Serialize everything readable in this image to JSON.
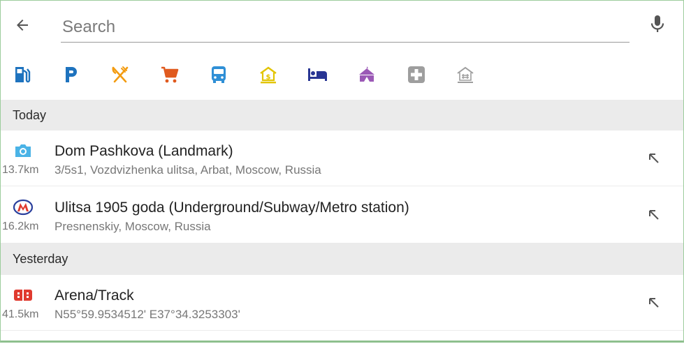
{
  "search": {
    "placeholder": "Search",
    "value": ""
  },
  "icons": {
    "back": "arrow-left-icon",
    "mic": "microphone-icon",
    "fill_arrow": "arrow-up-left-icon"
  },
  "categories": [
    {
      "name": "fuel",
      "icon": "gas-station-icon",
      "color": "#1e73be"
    },
    {
      "name": "parking",
      "icon": "parking-icon",
      "color": "#1e73be"
    },
    {
      "name": "food",
      "icon": "restaurant-icon",
      "color": "#f39c12"
    },
    {
      "name": "shopping",
      "icon": "cart-icon",
      "color": "#e05a1e"
    },
    {
      "name": "transport",
      "icon": "bus-icon",
      "color": "#2f8fd6"
    },
    {
      "name": "finance",
      "icon": "bank-icon",
      "color": "#e2c400"
    },
    {
      "name": "hotel",
      "icon": "bed-icon",
      "color": "#283593"
    },
    {
      "name": "entertainment",
      "icon": "circus-tent-icon",
      "color": "#9b59b6"
    },
    {
      "name": "health",
      "icon": "medical-cross-icon",
      "color": "#9e9e9e"
    },
    {
      "name": "more",
      "icon": "grid-house-icon",
      "color": "#9e9e9e"
    }
  ],
  "sections": [
    {
      "label": "Today",
      "items": [
        {
          "title": "Dom Pashkova (Landmark)",
          "subtitle": "3/5s1, Vozdvizhenka ulitsa, Arbat, Moscow, Russia",
          "distance": "13.7km",
          "icon": "camera-icon",
          "icon_color": "#4ab3e6"
        },
        {
          "title": "Ulitsa 1905 goda (Underground/Subway/Metro station)",
          "subtitle": "Presnenskiy, Moscow, Russia",
          "distance": "16.2km",
          "icon": "metro-icon",
          "icon_color": "#e03a2f"
        }
      ]
    },
    {
      "label": "Yesterday",
      "items": [
        {
          "title": "Arena/Track",
          "subtitle": "N55°59.9534512' E37°34.3253303'",
          "distance": "41.5km",
          "icon": "arena-icon",
          "icon_color": "#e03a2f"
        }
      ]
    }
  ]
}
